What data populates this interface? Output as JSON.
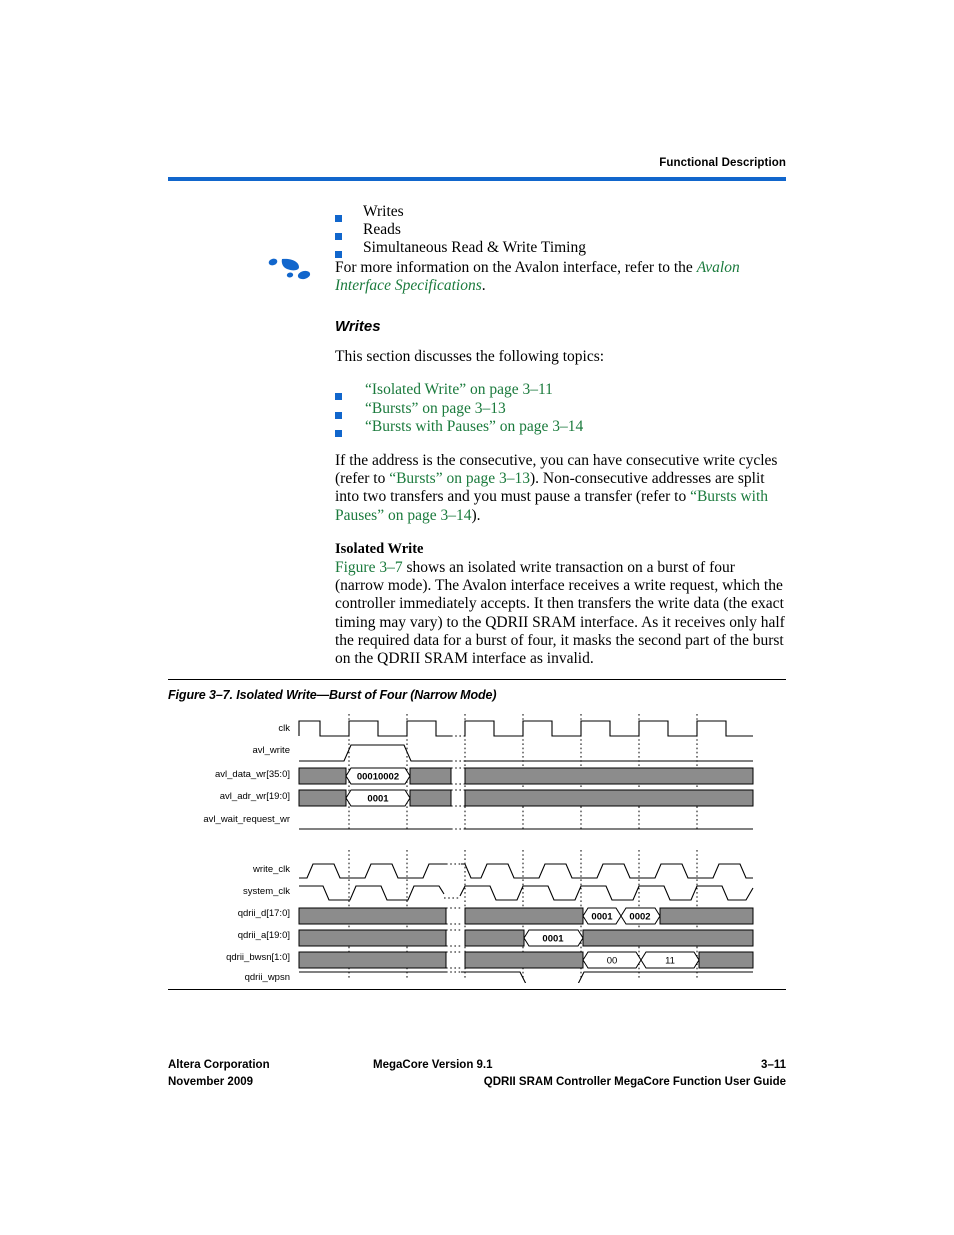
{
  "header": {
    "title": "Functional Description",
    "rule_color": "#1166cc"
  },
  "top_bullets": {
    "items": [
      "Writes",
      "Reads",
      "Simultaneous Read & Write Timing"
    ]
  },
  "note": {
    "icon": "footprint-icon",
    "text_before": "For more information on the Avalon interface, refer to the ",
    "link_text": "Avalon Interface Specifications",
    "text_after": "."
  },
  "writes_section": {
    "heading": "Writes",
    "intro": "This section discusses the following topics:",
    "links": [
      "“Isolated Write” on page 3–11",
      "“Bursts” on page 3–13",
      "“Bursts with Pauses” on page 3–14"
    ],
    "para_seg_1": "If the address is the consecutive, you can have consecutive write cycles (refer to ",
    "para_link_1": "“Bursts” on page 3–13",
    "para_seg_2": "). Non-consecutive addresses are split into two transfers and you must pause a transfer (refer to ",
    "para_link_2": "“Bursts with Pauses” on page 3–14",
    "para_seg_3": ")."
  },
  "isolated_write": {
    "subheading": "Isolated Write",
    "link_figure": "Figure 3–7",
    "body": " shows an isolated write transaction on a burst of four (narrow mode). The Avalon interface receives a write request, which the controller immediately accepts. It then transfers the write data (the exact timing may vary) to the QDRII SRAM interface. As it receives only half the required data for a burst of four, it masks the second part of the burst on the QDRII SRAM interface as invalid."
  },
  "figure": {
    "caption": "Figure 3–7. Isolated Write—Burst of Four (Narrow Mode)",
    "signals": [
      {
        "name": "clk",
        "type": "clock"
      },
      {
        "name": "avl_write",
        "type": "logic"
      },
      {
        "name": "avl_data_wr[35:0]",
        "type": "bus",
        "values": [
          "00010002"
        ]
      },
      {
        "name": "avl_adr_wr[19:0]",
        "type": "bus",
        "values": [
          "0001"
        ]
      },
      {
        "name": "avl_wait_request_wr",
        "type": "logic"
      },
      {
        "name": "write_clk",
        "type": "clock"
      },
      {
        "name": "system_clk",
        "type": "clock"
      },
      {
        "name": "qdrii_d[17:0]",
        "type": "bus",
        "values": [
          "0001",
          "0002"
        ]
      },
      {
        "name": "qdrii_a[19:0]",
        "type": "bus",
        "values": [
          "0001"
        ]
      },
      {
        "name": "qdrii_bwsn[1:0]",
        "type": "bus",
        "values": [
          "00",
          "11"
        ]
      },
      {
        "name": "qdrii_wpsn",
        "type": "logic"
      }
    ],
    "bus_fill": "#8c8c8c",
    "break_marker": "dotted-time-break"
  },
  "footer": {
    "left_line1": "Altera Corporation",
    "left_line2": "November 2009",
    "mid_line1": "MegaCore Version 9.1",
    "mid_line2": "QDRII SRAM Controller MegaCore Function User Guide",
    "right_line1": "3–11"
  }
}
